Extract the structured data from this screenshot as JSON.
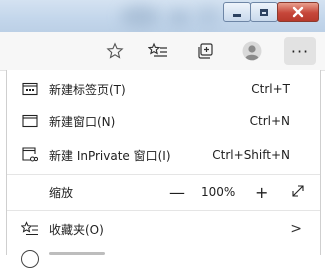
{
  "menu": {
    "items": [
      {
        "icon": "new-tab-icon",
        "label": "新建标签页(T)",
        "shortcut": "Ctrl+T"
      },
      {
        "icon": "new-window-icon",
        "label": "新建窗口(N)",
        "shortcut": "Ctrl+N"
      },
      {
        "icon": "inprivate-window-icon",
        "label": "新建 InPrivate 窗口(I)",
        "shortcut": "Ctrl+Shift+N"
      }
    ],
    "zoom": {
      "label": "缩放",
      "minus": "—",
      "value": "100%",
      "plus": "+"
    },
    "favorites": {
      "icon": "favorites-star-icon",
      "label": "收藏夹(O)",
      "chevron": ">"
    }
  },
  "toolbar": {
    "icons": [
      "favorite-star-icon",
      "favorites-list-icon",
      "collections-icon",
      "profile-avatar-icon",
      "more-options-icon"
    ],
    "more_label": "···"
  }
}
